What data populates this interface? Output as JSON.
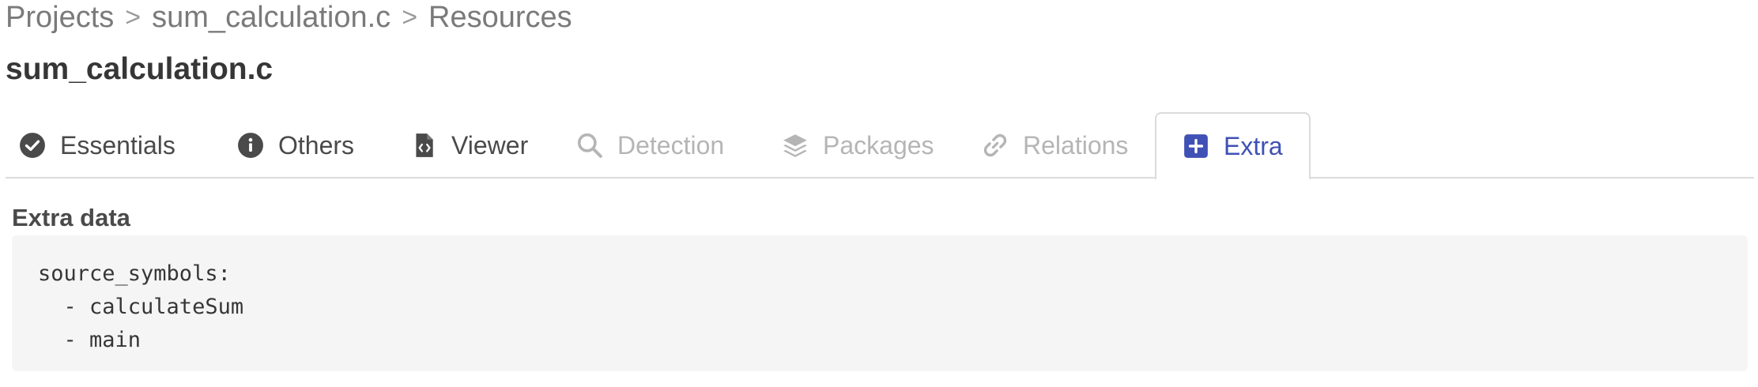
{
  "breadcrumb": {
    "items": [
      "Projects",
      "sum_calculation.c",
      "Resources"
    ],
    "separator": ">"
  },
  "page_title": "sum_calculation.c",
  "tabs": [
    {
      "label": "Essentials",
      "icon": "check-circle-icon",
      "state": "normal"
    },
    {
      "label": "Others",
      "icon": "info-circle-icon",
      "state": "normal"
    },
    {
      "label": "Viewer",
      "icon": "code-file-icon",
      "state": "normal"
    },
    {
      "label": "Detection",
      "icon": "search-icon",
      "state": "disabled"
    },
    {
      "label": "Packages",
      "icon": "layers-icon",
      "state": "disabled"
    },
    {
      "label": "Relations",
      "icon": "link-icon",
      "state": "disabled"
    },
    {
      "label": "Extra",
      "icon": "plus-square-icon",
      "state": "active"
    }
  ],
  "extra": {
    "section_label": "Extra data",
    "code": "source_symbols:\n  - calculateSum\n  - main"
  },
  "colors": {
    "accent": "#3f51b5",
    "muted": "#b5b5b5",
    "text": "#4a4a4a",
    "code_bg": "#f5f5f5"
  }
}
